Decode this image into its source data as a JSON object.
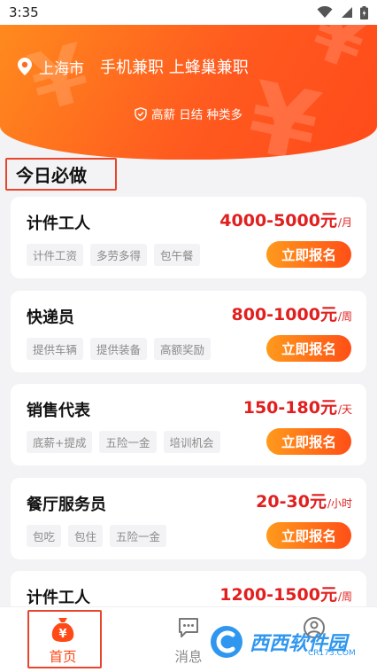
{
  "status_bar": {
    "time": "3:35"
  },
  "header": {
    "city": "上海市",
    "title": "手机兼职 上蜂巢兼职",
    "tagline": "高薪 日结 种类多"
  },
  "section": {
    "title": "今日必做"
  },
  "jobs": [
    {
      "title": "计件工人",
      "salary": "4000-5000元",
      "unit": "/月",
      "tags": [
        "计件工资",
        "多劳多得",
        "包午餐"
      ],
      "button": "立即报名"
    },
    {
      "title": "快递员",
      "salary": "800-1000元",
      "unit": "/周",
      "tags": [
        "提供车辆",
        "提供装备",
        "高额奖励"
      ],
      "button": "立即报名"
    },
    {
      "title": "销售代表",
      "salary": "150-180元",
      "unit": "/天",
      "tags": [
        "底薪+提成",
        "五险一金",
        "培训机会"
      ],
      "button": "立即报名"
    },
    {
      "title": "餐厅服务员",
      "salary": "20-30元",
      "unit": "/小时",
      "tags": [
        "包吃",
        "包住",
        "五险一金"
      ],
      "button": "立即报名"
    },
    {
      "title": "计件工人",
      "salary": "1200-1500元",
      "unit": "/周",
      "tags": [],
      "button": ""
    }
  ],
  "tabbar": {
    "home": "首页",
    "messages": "消息",
    "me": ""
  },
  "watermark": {
    "brand": "西西软件园",
    "site": "CR173.COM"
  },
  "colors": {
    "accent": "#ff5a1f",
    "salary": "#e11f1f",
    "highlight_box": "#e8452e"
  }
}
